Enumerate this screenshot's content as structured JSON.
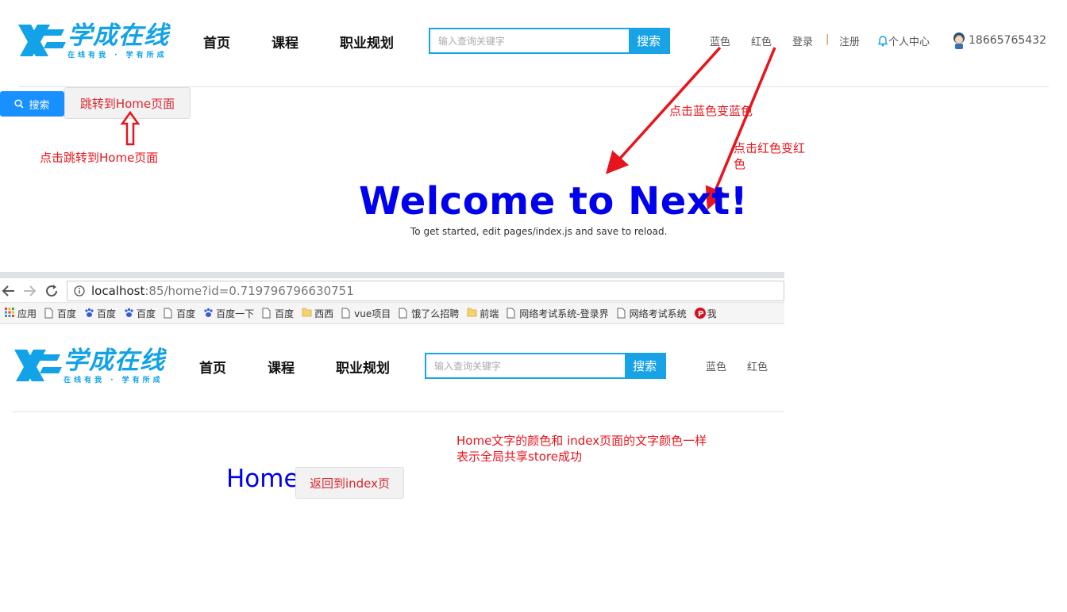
{
  "header": {
    "logo_title": "学成在线",
    "logo_slogan": "在线有我 · 学有所成",
    "nav": [
      "首页",
      "课程",
      "职业规划"
    ],
    "search_placeholder": "输入查询关键字",
    "search_button": "搜索",
    "links": {
      "blue": "蓝色",
      "red": "红色",
      "login": "登录",
      "separator": "|",
      "register": "注册",
      "user_center": "个人中心",
      "phone": "18665765432"
    }
  },
  "actions": {
    "search_button": "搜索",
    "goto_home_button": "跳转到Home页面"
  },
  "annotations": {
    "goto_home_note": "点击跳转到Home页面",
    "blue_note": "点击蓝色变蓝色",
    "red_note_line1": "点击红色变红",
    "red_note_line2": "色",
    "shared_note_line1": "Home文字的颜色和 index页面的文字颜色一样",
    "shared_note_line2": "表示全局共享store成功"
  },
  "welcome": {
    "title": "Welcome to Next!",
    "subtitle": "To get started, edit pages/index.js and save to reload."
  },
  "browser": {
    "url_host": "localhost",
    "url_rest": ":85/home?id=0.719796796630751",
    "bookmarks": [
      {
        "label": "应用",
        "icon": "apps-grid-icon"
      },
      {
        "label": "百度",
        "icon": "page-icon"
      },
      {
        "label": "百度",
        "icon": "baidu-paw-icon"
      },
      {
        "label": "百度",
        "icon": "baidu-paw-icon"
      },
      {
        "label": "百度",
        "icon": "page-icon"
      },
      {
        "label": "百度一下",
        "icon": "baidu-paw-icon"
      },
      {
        "label": "百度",
        "icon": "page-icon"
      },
      {
        "label": "西西",
        "icon": "folder-icon"
      },
      {
        "label": "vue项目",
        "icon": "page-icon"
      },
      {
        "label": "饿了么招聘",
        "icon": "page-icon"
      },
      {
        "label": "前端",
        "icon": "folder-icon"
      },
      {
        "label": "网络考试系统-登录界",
        "icon": "page-icon"
      },
      {
        "label": "网络考试系统",
        "icon": "page-icon"
      },
      {
        "label": "我",
        "icon": "red-p-icon"
      }
    ]
  },
  "home_page": {
    "title": "Home",
    "back_button": "返回到index页"
  },
  "colors": {
    "brand": "#12a2e8",
    "accent_blue": "#1890ff",
    "text_blue": "#0000ee",
    "annotation_red": "#e8141c"
  }
}
